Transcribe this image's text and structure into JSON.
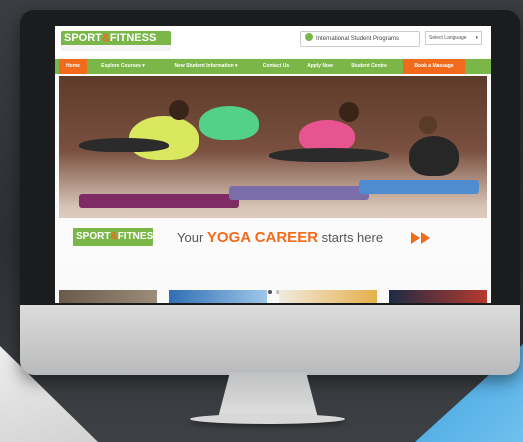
{
  "site": {
    "logo_top": "SPORT",
    "logo_amp": "&",
    "logo_bottom": "FITNESS",
    "intl_label": "International Student Programs",
    "lang_label": "Select Language"
  },
  "nav": {
    "items": [
      {
        "label": "Home",
        "active": true
      },
      {
        "label": "Explore Courses",
        "active": false
      },
      {
        "label": "New Student Information",
        "active": false
      },
      {
        "label": "Contact Us",
        "active": false
      },
      {
        "label": "Apply Now",
        "active": false
      },
      {
        "label": "Student Centre",
        "active": false
      },
      {
        "label": "Book a Massage",
        "active": false
      }
    ]
  },
  "hero": {
    "tagline_pre": "Your",
    "tagline_highlight": "YOGA CAREER",
    "tagline_post": "starts here"
  },
  "colors": {
    "brand_green": "#7ab648",
    "brand_orange": "#f26b1d"
  },
  "icons": {
    "globe": "globe-icon",
    "arrows": "double-arrow-right-icon",
    "dropdown": "chevron-down-icon"
  }
}
